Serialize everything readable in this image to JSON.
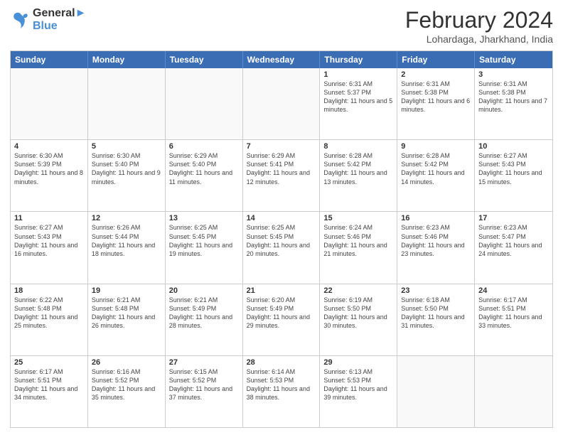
{
  "header": {
    "logo_line1": "General",
    "logo_line2": "Blue",
    "month_year": "February 2024",
    "location": "Lohardaga, Jharkhand, India"
  },
  "day_headers": [
    "Sunday",
    "Monday",
    "Tuesday",
    "Wednesday",
    "Thursday",
    "Friday",
    "Saturday"
  ],
  "weeks": [
    [
      {
        "day": "",
        "info": "",
        "empty": true
      },
      {
        "day": "",
        "info": "",
        "empty": true
      },
      {
        "day": "",
        "info": "",
        "empty": true
      },
      {
        "day": "",
        "info": "",
        "empty": true
      },
      {
        "day": "1",
        "info": "Sunrise: 6:31 AM\nSunset: 5:37 PM\nDaylight: 11 hours and 5 minutes.",
        "empty": false
      },
      {
        "day": "2",
        "info": "Sunrise: 6:31 AM\nSunset: 5:38 PM\nDaylight: 11 hours and 6 minutes.",
        "empty": false
      },
      {
        "day": "3",
        "info": "Sunrise: 6:31 AM\nSunset: 5:38 PM\nDaylight: 11 hours and 7 minutes.",
        "empty": false
      }
    ],
    [
      {
        "day": "4",
        "info": "Sunrise: 6:30 AM\nSunset: 5:39 PM\nDaylight: 11 hours and 8 minutes.",
        "empty": false
      },
      {
        "day": "5",
        "info": "Sunrise: 6:30 AM\nSunset: 5:40 PM\nDaylight: 11 hours and 9 minutes.",
        "empty": false
      },
      {
        "day": "6",
        "info": "Sunrise: 6:29 AM\nSunset: 5:40 PM\nDaylight: 11 hours and 11 minutes.",
        "empty": false
      },
      {
        "day": "7",
        "info": "Sunrise: 6:29 AM\nSunset: 5:41 PM\nDaylight: 11 hours and 12 minutes.",
        "empty": false
      },
      {
        "day": "8",
        "info": "Sunrise: 6:28 AM\nSunset: 5:42 PM\nDaylight: 11 hours and 13 minutes.",
        "empty": false
      },
      {
        "day": "9",
        "info": "Sunrise: 6:28 AM\nSunset: 5:42 PM\nDaylight: 11 hours and 14 minutes.",
        "empty": false
      },
      {
        "day": "10",
        "info": "Sunrise: 6:27 AM\nSunset: 5:43 PM\nDaylight: 11 hours and 15 minutes.",
        "empty": false
      }
    ],
    [
      {
        "day": "11",
        "info": "Sunrise: 6:27 AM\nSunset: 5:43 PM\nDaylight: 11 hours and 16 minutes.",
        "empty": false
      },
      {
        "day": "12",
        "info": "Sunrise: 6:26 AM\nSunset: 5:44 PM\nDaylight: 11 hours and 18 minutes.",
        "empty": false
      },
      {
        "day": "13",
        "info": "Sunrise: 6:25 AM\nSunset: 5:45 PM\nDaylight: 11 hours and 19 minutes.",
        "empty": false
      },
      {
        "day": "14",
        "info": "Sunrise: 6:25 AM\nSunset: 5:45 PM\nDaylight: 11 hours and 20 minutes.",
        "empty": false
      },
      {
        "day": "15",
        "info": "Sunrise: 6:24 AM\nSunset: 5:46 PM\nDaylight: 11 hours and 21 minutes.",
        "empty": false
      },
      {
        "day": "16",
        "info": "Sunrise: 6:23 AM\nSunset: 5:46 PM\nDaylight: 11 hours and 23 minutes.",
        "empty": false
      },
      {
        "day": "17",
        "info": "Sunrise: 6:23 AM\nSunset: 5:47 PM\nDaylight: 11 hours and 24 minutes.",
        "empty": false
      }
    ],
    [
      {
        "day": "18",
        "info": "Sunrise: 6:22 AM\nSunset: 5:48 PM\nDaylight: 11 hours and 25 minutes.",
        "empty": false
      },
      {
        "day": "19",
        "info": "Sunrise: 6:21 AM\nSunset: 5:48 PM\nDaylight: 11 hours and 26 minutes.",
        "empty": false
      },
      {
        "day": "20",
        "info": "Sunrise: 6:21 AM\nSunset: 5:49 PM\nDaylight: 11 hours and 28 minutes.",
        "empty": false
      },
      {
        "day": "21",
        "info": "Sunrise: 6:20 AM\nSunset: 5:49 PM\nDaylight: 11 hours and 29 minutes.",
        "empty": false
      },
      {
        "day": "22",
        "info": "Sunrise: 6:19 AM\nSunset: 5:50 PM\nDaylight: 11 hours and 30 minutes.",
        "empty": false
      },
      {
        "day": "23",
        "info": "Sunrise: 6:18 AM\nSunset: 5:50 PM\nDaylight: 11 hours and 31 minutes.",
        "empty": false
      },
      {
        "day": "24",
        "info": "Sunrise: 6:17 AM\nSunset: 5:51 PM\nDaylight: 11 hours and 33 minutes.",
        "empty": false
      }
    ],
    [
      {
        "day": "25",
        "info": "Sunrise: 6:17 AM\nSunset: 5:51 PM\nDaylight: 11 hours and 34 minutes.",
        "empty": false
      },
      {
        "day": "26",
        "info": "Sunrise: 6:16 AM\nSunset: 5:52 PM\nDaylight: 11 hours and 35 minutes.",
        "empty": false
      },
      {
        "day": "27",
        "info": "Sunrise: 6:15 AM\nSunset: 5:52 PM\nDaylight: 11 hours and 37 minutes.",
        "empty": false
      },
      {
        "day": "28",
        "info": "Sunrise: 6:14 AM\nSunset: 5:53 PM\nDaylight: 11 hours and 38 minutes.",
        "empty": false
      },
      {
        "day": "29",
        "info": "Sunrise: 6:13 AM\nSunset: 5:53 PM\nDaylight: 11 hours and 39 minutes.",
        "empty": false
      },
      {
        "day": "",
        "info": "",
        "empty": true
      },
      {
        "day": "",
        "info": "",
        "empty": true
      }
    ]
  ]
}
